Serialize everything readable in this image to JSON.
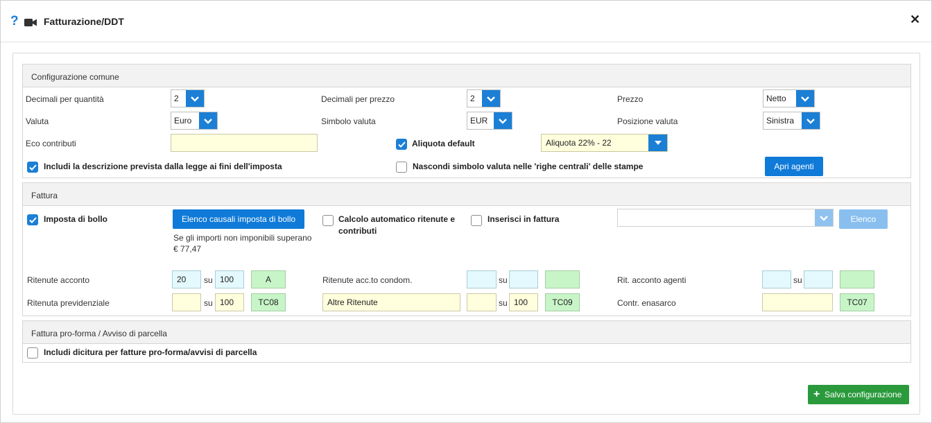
{
  "header": {
    "title": "Fatturazione/DDT",
    "help_glyph": "?",
    "close_glyph": "✕"
  },
  "common": {
    "title": "Configurazione comune",
    "decimali_quantita": {
      "label": "Decimali per quantità",
      "value": "2"
    },
    "decimali_prezzo": {
      "label": "Decimali per prezzo",
      "value": "2"
    },
    "prezzo": {
      "label": "Prezzo",
      "value": "Netto"
    },
    "valuta": {
      "label": "Valuta",
      "value": "Euro"
    },
    "simbolo_valuta": {
      "label": "Simbolo valuta",
      "value": "EUR"
    },
    "posizione_valuta": {
      "label": "Posizione valuta",
      "value": "Sinistra"
    },
    "eco_contributi": {
      "label": "Eco contributi",
      "value": ""
    },
    "aliquota_default": {
      "label": "Aliquota default",
      "checked": true,
      "value": "Aliquota 22% - 22"
    },
    "includi_descrizione": {
      "label": "Includi la descrizione prevista dalla legge ai fini dell'imposta",
      "checked": true
    },
    "nascondi_simbolo": {
      "label": "Nascondi simbolo valuta nelle 'righe centrali' delle stampe",
      "checked": false
    },
    "apri_agenti_label": "Apri agenti"
  },
  "fattura": {
    "title": "Fattura",
    "imposta_bollo": {
      "label": "Imposta di bollo",
      "checked": true
    },
    "elenco_causali_label": "Elenco causali imposta di bollo",
    "bollo_note_line1": "Se gli importi non imponibili superano",
    "bollo_note_line2": "€ 77,47",
    "calcolo_auto": {
      "label_line1": "Calcolo automatico ritenute e",
      "label_line2": "contributi",
      "checked": false
    },
    "inserisci_fattura": {
      "label": "Inserisci in fattura",
      "checked": false
    },
    "inserisci_select_value": "",
    "elenco_label": "Elenco",
    "su_label": "su",
    "ritenute_acconto": {
      "label": "Ritenute acconto",
      "value": "20",
      "base": "100",
      "code": "A"
    },
    "ritenute_condom": {
      "label": "Ritenute acc.to condom.",
      "value": "",
      "base": "",
      "code": ""
    },
    "rit_agenti": {
      "label": "Rit. acconto agenti",
      "value": "",
      "base": "",
      "code": ""
    },
    "ritenuta_previdenziale": {
      "label": "Ritenuta previdenziale",
      "value": "",
      "base": "100",
      "code": "TC08"
    },
    "altre_ritenute": {
      "label": "Altre Ritenute",
      "value": "",
      "base": "100",
      "code": "TC09"
    },
    "contr_enasarco": {
      "label": "Contr. enasarco",
      "value": "",
      "code": "TC07"
    }
  },
  "proforma": {
    "title": "Fattura pro-forma / Avviso di parcella",
    "includi_dicitura": {
      "label": "Includi dicitura per fatture pro-forma/avvisi di parcella",
      "checked": false
    }
  },
  "footer": {
    "save_label": "Salva configurazione"
  },
  "colors": {
    "primary": "#1b7fd6",
    "success": "#2a9a3c",
    "yellow_field": "#ffffde",
    "cyan_field": "#e4f9fd",
    "green_field": "#c8f5c8"
  }
}
